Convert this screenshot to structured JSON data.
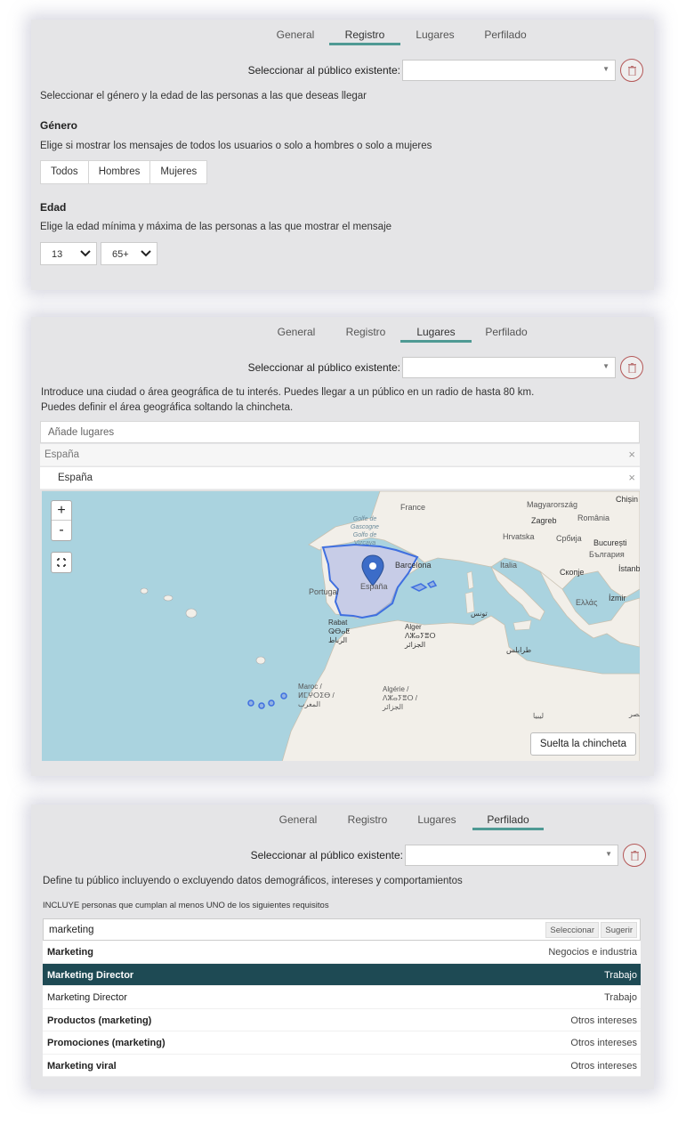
{
  "tabs": [
    "General",
    "Registro",
    "Lugares",
    "Perfilado"
  ],
  "selector": {
    "label": "Seleccionar al público existente:",
    "value": ""
  },
  "registro": {
    "intro": "Seleccionar el género y la edad de las personas a las que deseas llegar",
    "gender_heading": "Género",
    "gender_desc": "Elige si mostrar los mensajes de todos los usuarios o solo a hombres o solo a mujeres",
    "gender_options": [
      "Todos",
      "Hombres",
      "Mujeres"
    ],
    "age_heading": "Edad",
    "age_desc": "Elige la edad mínima y máxima de las personas a las que mostrar el mensaje",
    "age_min": "13",
    "age_max": "65+"
  },
  "lugares": {
    "intro1": "Introduce una ciudad o área geográfica de tu interés. Puedes llegar a un público en un radio de hasta 80 km.",
    "intro2": "Puedes definir el área geográfica soltando la chincheta.",
    "placeholder": "Añade lugares",
    "places": [
      {
        "label": "España"
      },
      {
        "label": "España"
      }
    ],
    "zoom_in": "+",
    "zoom_out": "-",
    "drop_pin_label": "Suelta la chincheta",
    "map_labels": {
      "france": "France",
      "golfo": "Golfe de Gascogne Golfo de Vizcaya",
      "portugal": "Portugal",
      "espana": "España",
      "barcelona": "Barcelona",
      "italia": "Italia",
      "hrvatska": "Hrvatska",
      "zagreb": "Zagreb",
      "magyarorszag": "Magyarország",
      "romania": "România",
      "srbija": "Србија",
      "bucuresti": "București",
      "bulgaria": "България",
      "chisin": "Chișin",
      "skopje": "Скопје",
      "ellas": "Ελλάς",
      "istanbul": "İstanb",
      "izmir": "İzmir",
      "rabat": "Rabat ⵕⴱⴰⵟ الرباط",
      "alger": "Alger ⴷⵣⴰⵢⴻⵔ الجزائر",
      "tunis": "تونس",
      "tarabulus": "طرابلس",
      "maroc": "Maroc / ⵍⵎⵖⵔⵉⴱ / المغرب",
      "algerie": "Algérie / ⴷⵣⴰⵢⴻⵔ / الجزائر",
      "libya": "ليبيا",
      "misr": "مصر"
    }
  },
  "perfilado": {
    "intro": "Define tu público incluyendo o excluyendo datos demográficos, intereses y comportamientos",
    "include_label": "INCLUYE personas que cumplan al menos UNO de los siguientes requisitos",
    "search_value": "marketing",
    "select_btn": "Seleccionar",
    "suggest_btn": "Sugerir",
    "results": [
      {
        "name": "Marketing",
        "category": "Negocios e industria",
        "selected": false
      },
      {
        "name": "Marketing Director",
        "category": "Trabajo",
        "selected": true
      },
      {
        "name": "Marketing Director",
        "category": "Trabajo",
        "selected": false
      },
      {
        "name": "Productos (marketing)",
        "category": "Otros intereses",
        "selected": false
      },
      {
        "name": "Promociones (marketing)",
        "category": "Otros intereses",
        "selected": false
      },
      {
        "name": "Marketing viral",
        "category": "Otros intereses",
        "selected": false
      }
    ]
  }
}
